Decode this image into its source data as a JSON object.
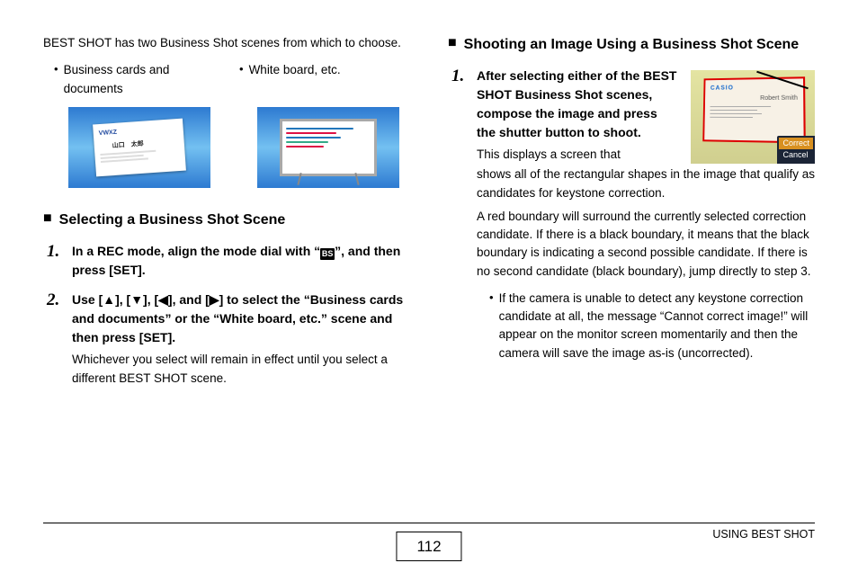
{
  "left": {
    "intro": "BEST SHOT has two Business Shot scenes from which to choose.",
    "bullets": {
      "a": "Business cards and documents",
      "b": "White board, etc."
    },
    "card_logo": "VWXZ",
    "card_name": "山口　太郎",
    "section_title": "Selecting a Business Shot Scene",
    "step1": {
      "pre": "In a REC mode, align the mode dial with “",
      "icon": "BS",
      "post": "”, and then press [SET]."
    },
    "step2": {
      "bold": "Use [▲], [▼], [◀], and [▶] to select the “Business cards and documents” or the “White board, etc.” scene and then press [SET].",
      "desc": "Whichever you select will remain in effect until you select a different BEST SHOT scene."
    }
  },
  "right": {
    "section_title": "Shooting an Image Using a Business Shot Scene",
    "step1_bold": "After selecting either of the BEST SHOT Business Shot scenes, compose the image and press the shutter button to shoot.",
    "img": {
      "casio": "CASIO",
      "name": "Robert Smith",
      "correct": "Correct",
      "cancel": "Cancel"
    },
    "desc1": "This displays a screen that",
    "desc2": "shows all of the rectangular shapes in the image that qualify as candidates for keystone correction.",
    "desc3": "A red boundary will surround the currently selected correction candidate. If there is a black boundary, it means that the black boundary is indicating a second possible candidate. If there is no second candidate (black boundary), jump directly to step 3.",
    "bullet": "If the camera is unable to detect any keystone correction candidate at all, the message “Cannot correct image!” will appear on the monitor screen momentarily and then the camera will save the image as-is (uncorrected)."
  },
  "footer": {
    "page": "112",
    "label": "USING BEST SHOT"
  }
}
